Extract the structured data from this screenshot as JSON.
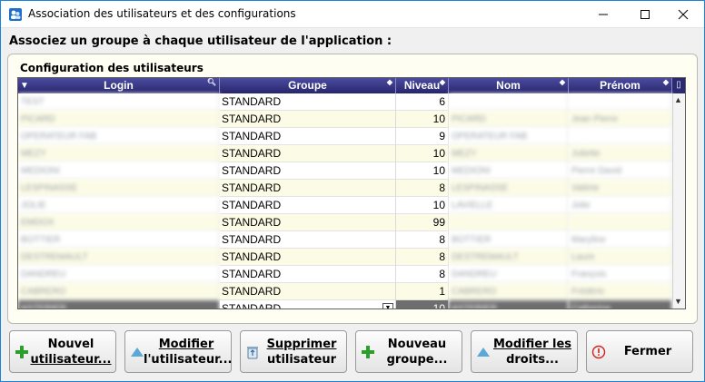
{
  "window": {
    "title": "Association des utilisateurs et des configurations"
  },
  "instruction": "Associez un groupe à chaque utilisateur de l'application :",
  "group_box": {
    "label": "Configuration des utilisateurs"
  },
  "table": {
    "columns": [
      "Login",
      "Groupe",
      "Niveau",
      "Nom",
      "Prénom"
    ],
    "rows": [
      {
        "login": "TEST",
        "groupe": "STANDARD",
        "niveau": "6",
        "nom": "",
        "prenom": ""
      },
      {
        "login": "PICARD",
        "groupe": "STANDARD",
        "niveau": "10",
        "nom": "PICARD",
        "prenom": "Jean Pierre"
      },
      {
        "login": "OPERATEUR FAB",
        "groupe": "STANDARD",
        "niveau": "9",
        "nom": "OPERATEUR FAB",
        "prenom": ""
      },
      {
        "login": "MEZY",
        "groupe": "STANDARD",
        "niveau": "10",
        "nom": "MEZY",
        "prenom": "Juliette"
      },
      {
        "login": "MEDIONI",
        "groupe": "STANDARD",
        "niveau": "10",
        "nom": "MEDIONI",
        "prenom": "Pierre David"
      },
      {
        "login": "LESPINASSE",
        "groupe": "STANDARD",
        "niveau": "8",
        "nom": "LESPINASSE",
        "prenom": "Valérie"
      },
      {
        "login": "JOLIE",
        "groupe": "STANDARD",
        "niveau": "10",
        "nom": "LAVIELLE",
        "prenom": "Jolie"
      },
      {
        "login": "EMDOX",
        "groupe": "STANDARD",
        "niveau": "99",
        "nom": "",
        "prenom": ""
      },
      {
        "login": "BOTTIER",
        "groupe": "STANDARD",
        "niveau": "8",
        "nom": "BOTTIER",
        "prenom": "Maryline"
      },
      {
        "login": "DESTREMAULT",
        "groupe": "STANDARD",
        "niveau": "8",
        "nom": "DESTREMAULT",
        "prenom": "Laure"
      },
      {
        "login": "DANDREU",
        "groupe": "STANDARD",
        "niveau": "8",
        "nom": "DANDREU",
        "prenom": "François"
      },
      {
        "login": "CABRERO",
        "groupe": "STANDARD",
        "niveau": "1",
        "nom": "CABRERO",
        "prenom": "Frédéric"
      },
      {
        "login": "ASTERIER",
        "groupe": "STANDARD",
        "niveau": "10",
        "nom": "ASTERIER",
        "prenom": "Catherine"
      }
    ]
  },
  "buttons": {
    "nouvel_utilisateur": {
      "line1": "Nouvel",
      "line2": "utilisateur...",
      "icon": "plus-icon"
    },
    "modifier_utilisateur": {
      "line1": "Modifier",
      "line2": "l'utilisateur...",
      "icon": "triangle-icon"
    },
    "supprimer_utilisateur": {
      "line1": "Supprimer",
      "line2": "utilisateur",
      "icon": "recycle-bin-icon"
    },
    "nouveau_groupe": {
      "line1": "Nouveau",
      "line2": "groupe...",
      "icon": "plus-icon"
    },
    "modifier_droits": {
      "line1": "Modifier les",
      "line2": "droits...",
      "icon": "triangle-icon"
    },
    "fermer": {
      "line1": "Fermer",
      "icon": "stop-icon"
    }
  },
  "colors": {
    "header_bg": "#2e2e78",
    "alt_row": "#fcfce6",
    "selected_row": "#6e6e6e",
    "plus_green": "#2aa02a",
    "triangle_blue": "#5aa8d8",
    "stop_red": "#d02020"
  }
}
